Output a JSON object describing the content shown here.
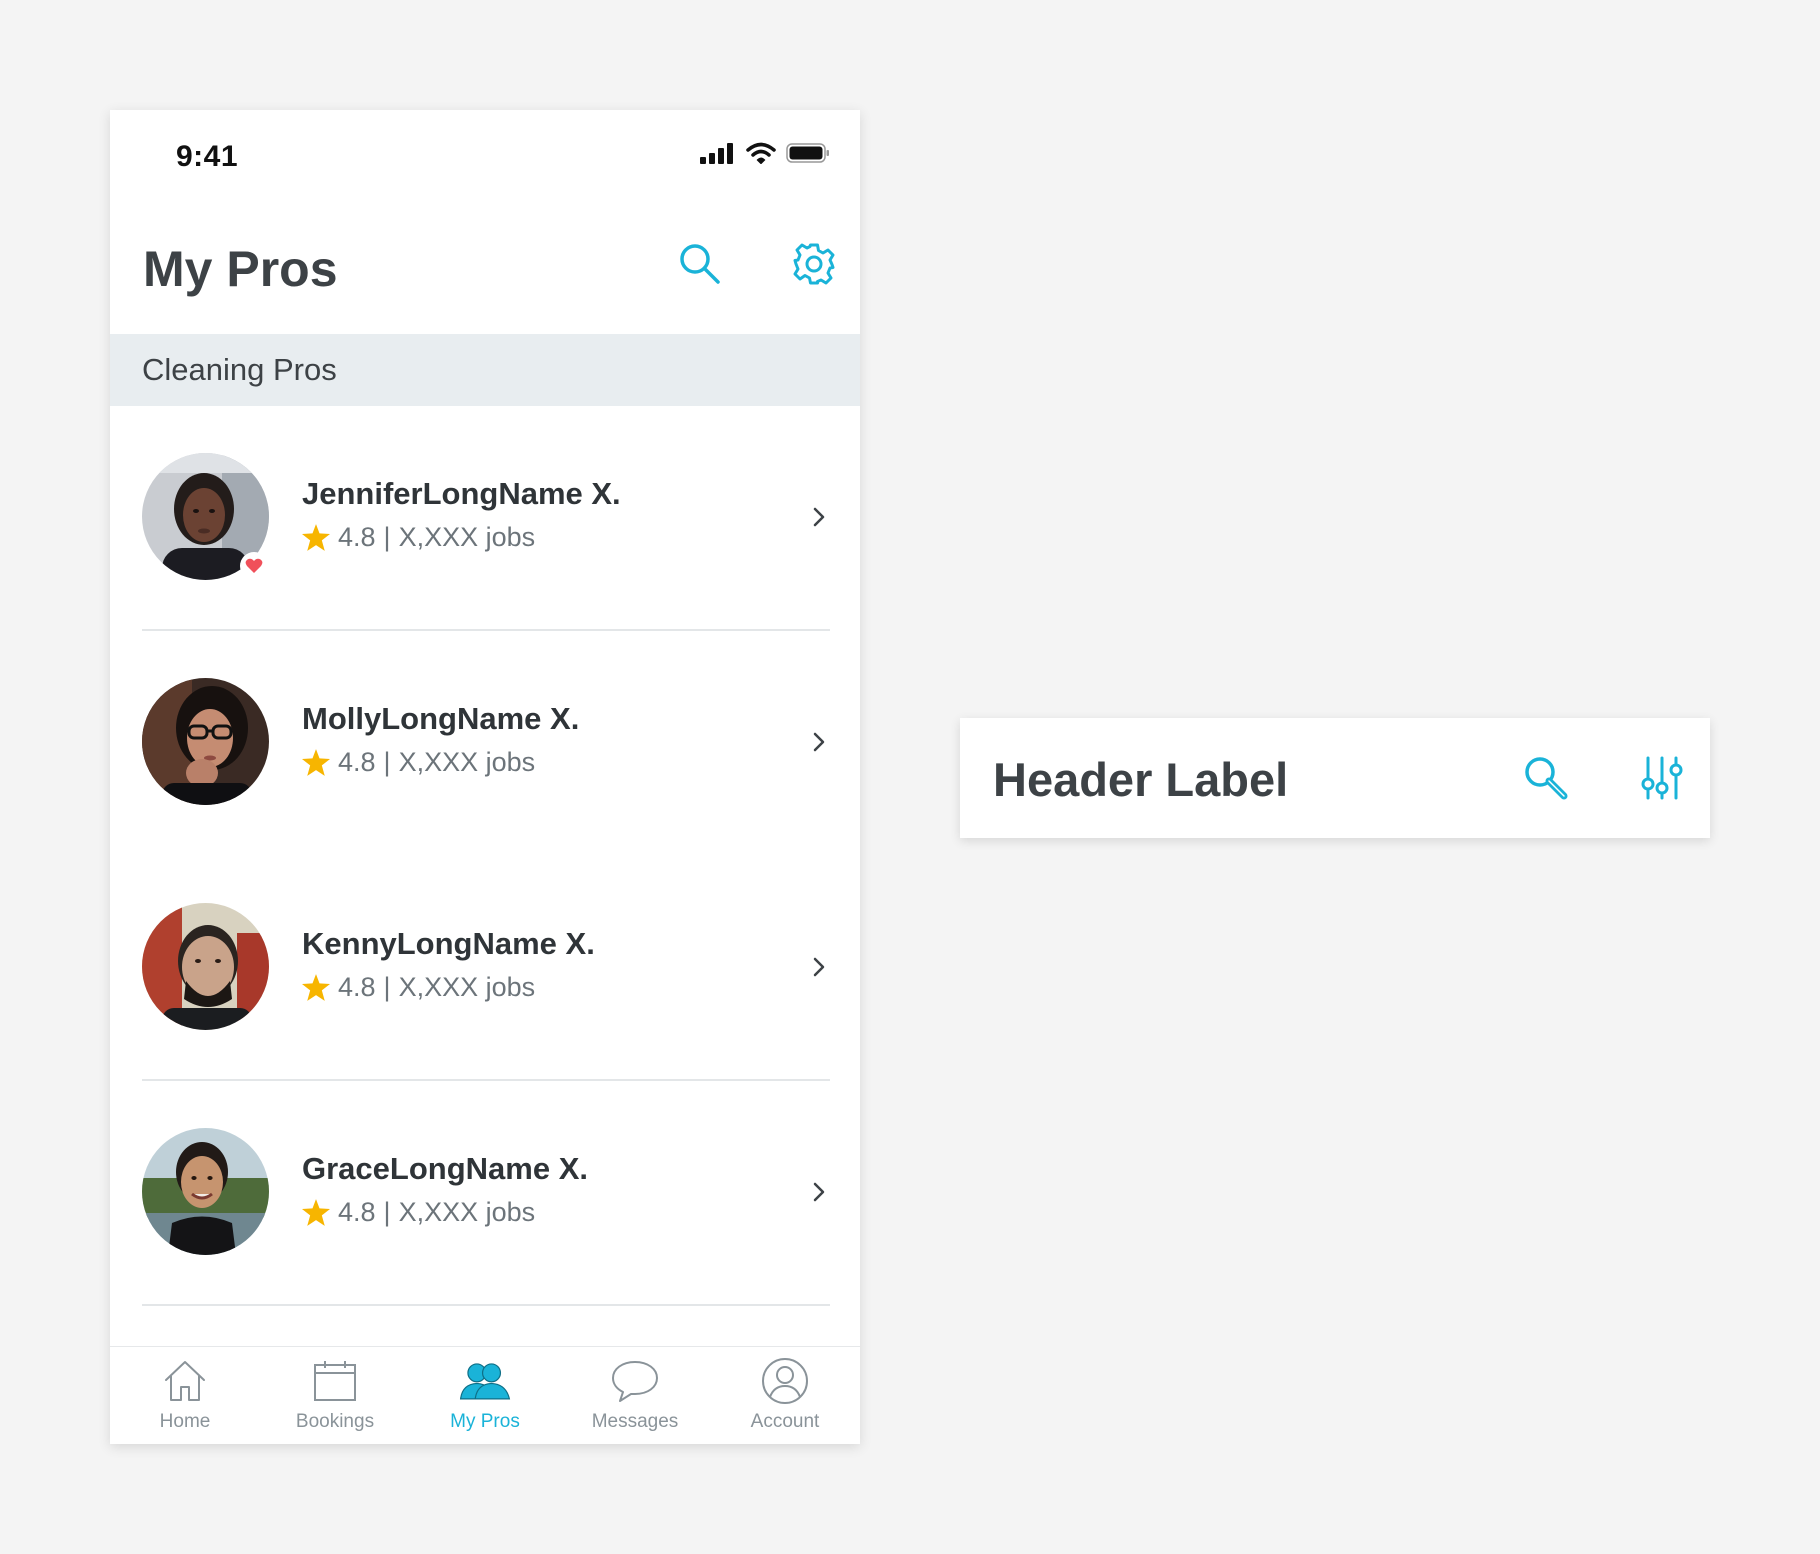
{
  "status_bar": {
    "time": "9:41"
  },
  "header": {
    "title": "My Pros",
    "search_icon": "search-icon",
    "settings_icon": "gear-icon"
  },
  "section": {
    "label": "Cleaning Pros"
  },
  "pros": [
    {
      "name": "JenniferLongName X.",
      "rating": "4.8",
      "separator": "|",
      "jobs": "X,XXX jobs",
      "favorite": true
    },
    {
      "name": "MollyLongName X.",
      "rating": "4.8",
      "separator": "|",
      "jobs": "X,XXX jobs",
      "favorite": false
    },
    {
      "name": "KennyLongName X.",
      "rating": "4.8",
      "separator": "|",
      "jobs": "X,XXX jobs",
      "favorite": false
    },
    {
      "name": "GraceLongName X.",
      "rating": "4.8",
      "separator": "|",
      "jobs": "X,XXX jobs",
      "favorite": false
    }
  ],
  "tabs": [
    {
      "label": "Home",
      "icon": "home-icon",
      "active": false
    },
    {
      "label": "Bookings",
      "icon": "calendar-icon",
      "active": false
    },
    {
      "label": "My Pros",
      "icon": "people-icon",
      "active": true
    },
    {
      "label": "Messages",
      "icon": "chat-bubble-icon",
      "active": false
    },
    {
      "label": "Account",
      "icon": "user-circle-icon",
      "active": false
    }
  ],
  "header_component": {
    "title": "Header Label",
    "search_icon": "magnifier-icon",
    "filter_icon": "sliders-icon"
  },
  "colors": {
    "accent": "#1ab3d8",
    "title_text": "#3d4246",
    "secondary_text": "#6c747a",
    "section_bg": "#e8edf0",
    "page_bg": "#f4f4f4",
    "star": "#f7b500",
    "heart": "#f0505a"
  }
}
